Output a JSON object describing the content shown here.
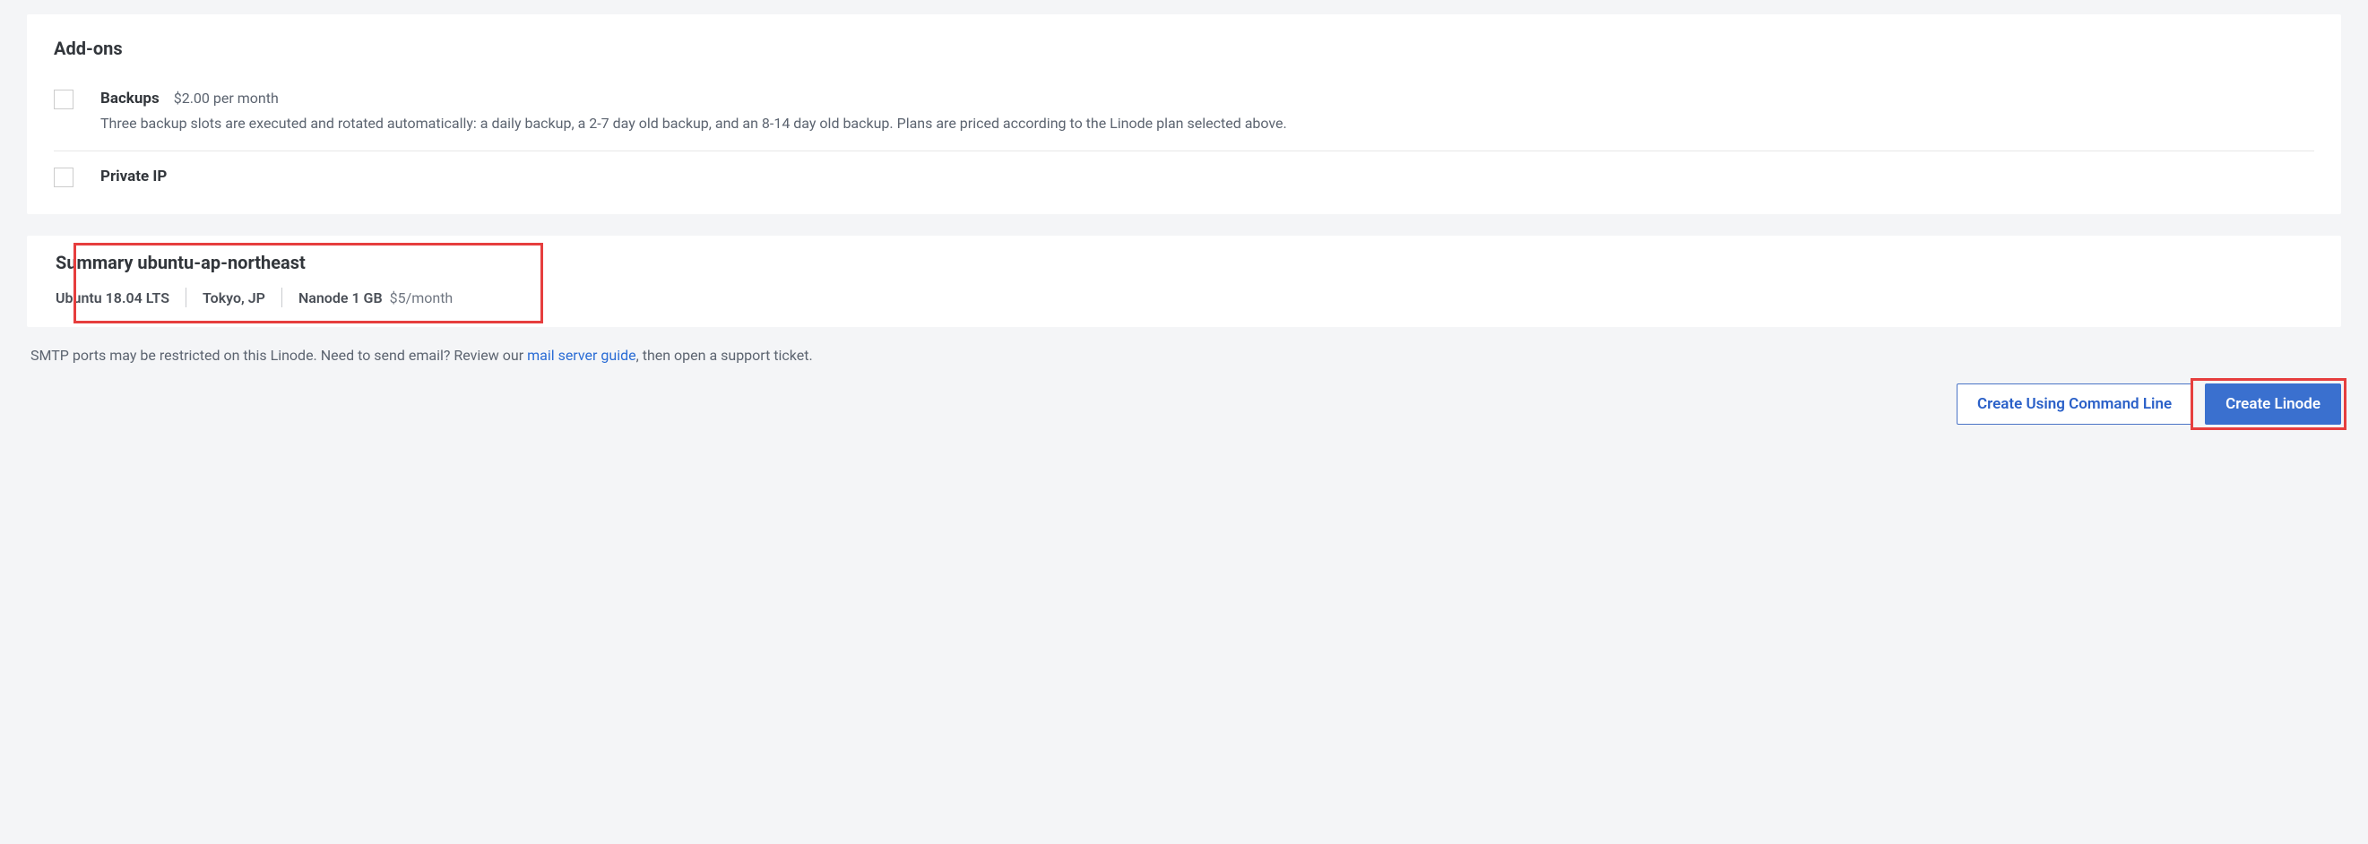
{
  "addons": {
    "title": "Add-ons",
    "backups": {
      "name": "Backups",
      "price": "$2.00 per month",
      "description": "Three backup slots are executed and rotated automatically: a daily backup, a 2-7 day old backup, and an 8-14 day old backup. Plans are priced according to the Linode plan selected above."
    },
    "private_ip": {
      "name": "Private IP"
    }
  },
  "summary": {
    "title": "Summary ubuntu-ap-northeast",
    "os": "Ubuntu 18.04 LTS",
    "region": "Tokyo, JP",
    "plan": "Nanode 1 GB",
    "plan_price": "$5/month"
  },
  "note": {
    "text_before": "SMTP ports may be restricted on this Linode. Need to send email? Review our ",
    "link_text": "mail server guide",
    "text_after": ", then open a support ticket."
  },
  "actions": {
    "cli": "Create Using Command Line",
    "create": "Create Linode"
  }
}
